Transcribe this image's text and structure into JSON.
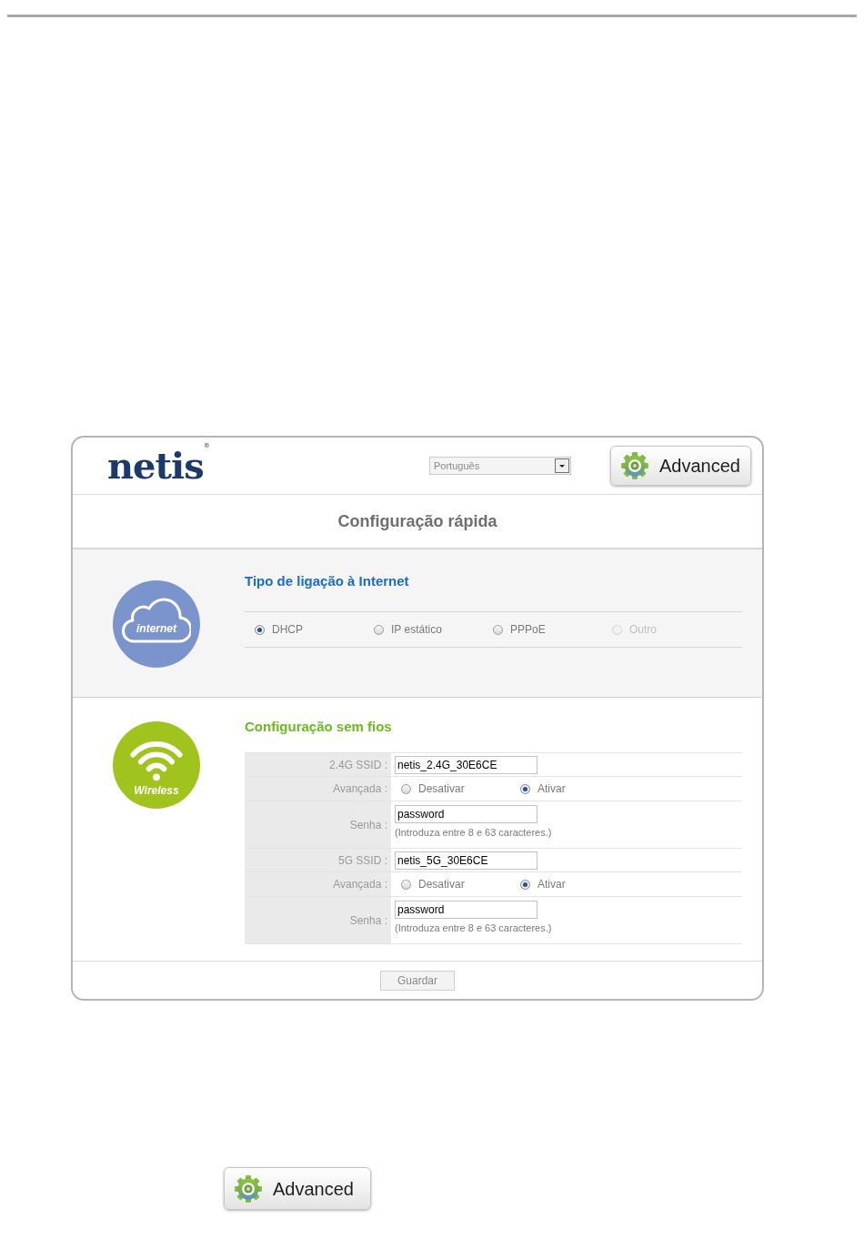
{
  "header": {
    "logo": "netis$^{®}$",
    "language": "Português",
    "advanced_button": "Advanced"
  },
  "page_title": "Configuração rápida",
  "internet": {
    "badge_label": "internet",
    "title": "Tipo de ligação à Internet",
    "options": [
      {
        "label": "DHCP",
        "selected": true,
        "disabled": false
      },
      {
        "label": "IP estático",
        "selected": false,
        "disabled": false
      },
      {
        "label": "PPPoE",
        "selected": false,
        "disabled": false
      },
      {
        "label": "Outro",
        "selected": false,
        "disabled": true
      }
    ]
  },
  "wireless": {
    "badge_label": "Wireless",
    "title": "Configuração sem fios",
    "rows": [
      {
        "kind": "text",
        "label": "2.4G SSID :",
        "value": "netis_2.4G_30E6CE"
      },
      {
        "kind": "choice",
        "label": "Avançada :",
        "options": [
          {
            "label": "Desativar",
            "selected": false
          },
          {
            "label": "Ativar",
            "selected": true
          }
        ]
      },
      {
        "kind": "password",
        "label": "Senha :",
        "value": "password",
        "hint": "(Introduza entre 8 e 63 caracteres.)"
      },
      {
        "kind": "text",
        "label": "5G SSID :",
        "value": "netis_5G_30E6CE"
      },
      {
        "kind": "choice",
        "label": "Avançada :",
        "options": [
          {
            "label": "Desativar",
            "selected": false
          },
          {
            "label": "Ativar",
            "selected": true
          }
        ]
      },
      {
        "kind": "password",
        "label": "Senha :",
        "value": "password",
        "hint": "(Introduza entre 8 e 63 caracteres.)"
      }
    ]
  },
  "save_button": "Guardar",
  "advanced_button": "Advanced"
}
